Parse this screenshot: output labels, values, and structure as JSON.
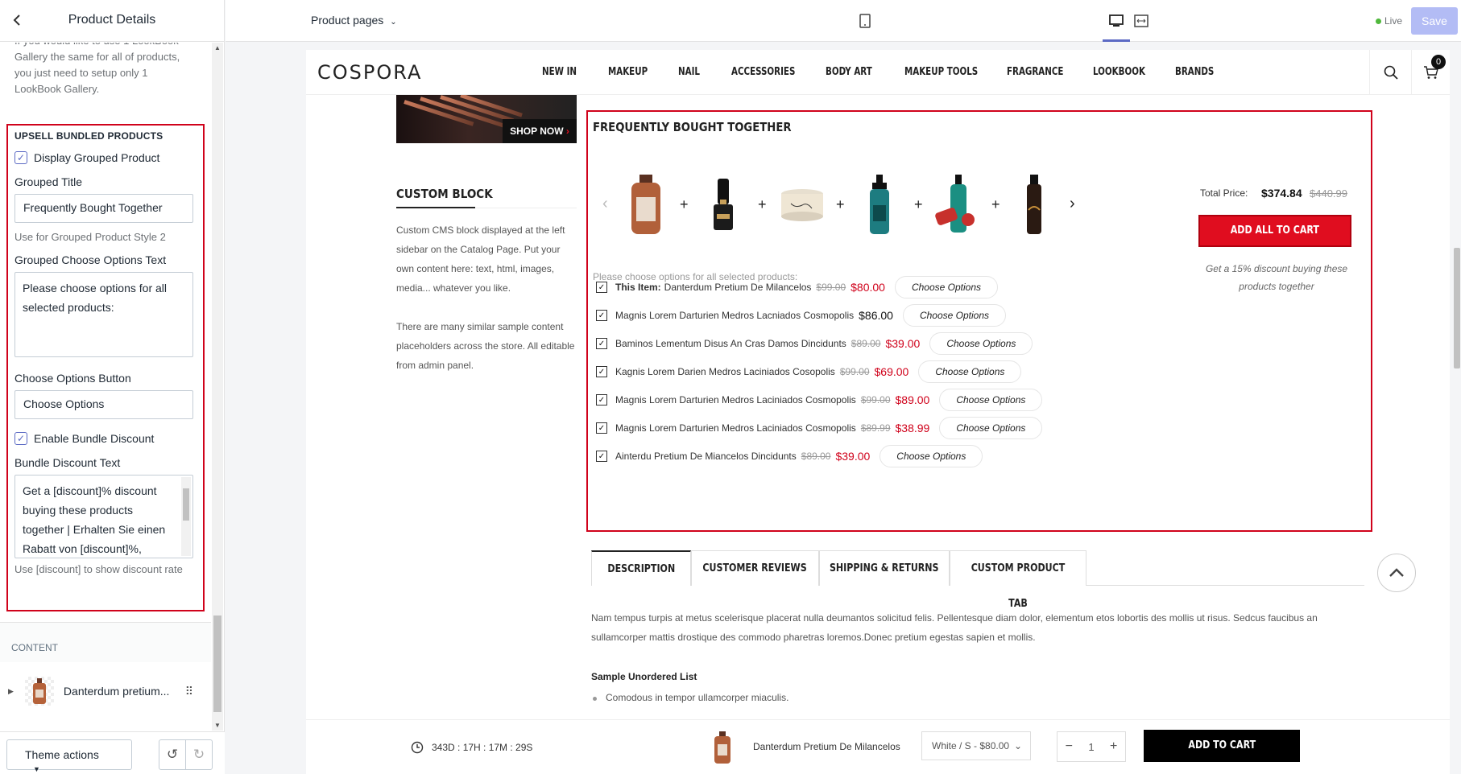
{
  "sidebar": {
    "title": "Product Details",
    "intro_text": "If you would like to use 1 LookBook Gallery the same for all of products, you just need to setup only 1 LookBook Gallery.",
    "upsell": {
      "heading": "UPSELL BUNDLED PRODUCTS",
      "display_grouped_label": "Display Grouped Product",
      "display_grouped_checked": true,
      "grouped_title_label": "Grouped Title",
      "grouped_title_value": "Frequently Bought Together",
      "grouped_title_help": "Use for Grouped Product Style 2",
      "choose_options_text_label": "Grouped Choose Options Text",
      "choose_options_text_value": "Please choose options for all selected products:",
      "choose_options_button_label": "Choose Options Button",
      "choose_options_button_value": "Choose Options",
      "enable_bundle_label": "Enable Bundle Discount",
      "enable_bundle_checked": true,
      "bundle_text_label": "Bundle Discount Text",
      "bundle_text_value": "Get a [discount]% discount buying these products together | Erhalten Sie einen Rabatt von [discount]%, wenn",
      "bundle_text_help": "Use [discount] to show discount rate"
    },
    "content_heading": "CONTENT",
    "content_item": "Danterdum pretium...",
    "footer": {
      "theme_actions": "Theme actions"
    }
  },
  "topbar": {
    "page_selector": "Product pages",
    "live_label": "Live",
    "save_label": "Save"
  },
  "store": {
    "logo": "COSPORA",
    "nav": [
      "NEW IN",
      "MAKEUP",
      "NAIL",
      "ACCESSORIES",
      "BODY ART",
      "MAKEUP TOOLS",
      "FRAGRANCE",
      "LOOKBOOK",
      "BRANDS"
    ],
    "cart_count": "0",
    "banner_button": "SHOP NOW",
    "custom_block": {
      "title": "CUSTOM BLOCK",
      "para1": "Custom CMS block displayed at the left sidebar on the Catalog Page. Put your own content here: text, html, images, media... whatever you like.",
      "para2": "There are many similar sample content placeholders across the store. All editable from admin panel."
    },
    "fbt": {
      "title": "FREQUENTLY BOUGHT TOGETHER",
      "total_label": "Total Price:",
      "total_price": "$374.84",
      "total_old": "$440.99",
      "add_all": "ADD ALL TO CART",
      "discount_text": "Get a 15% discount buying these products together",
      "choose_note": "Please choose options for all selected products:",
      "items": [
        {
          "prefix": "This Item:",
          "name": "Danterdum Pretium De Milancelos",
          "old": "$99.00",
          "price": "$80.00",
          "sale": true
        },
        {
          "prefix": "",
          "name": "Magnis Lorem Darturien Medros Lacniados Cosmopolis",
          "old": "",
          "price": "$86.00",
          "sale": false
        },
        {
          "prefix": "",
          "name": "Baminos Lementum Disus An Cras Damos Dincidunts",
          "old": "$89.00",
          "price": "$39.00",
          "sale": true
        },
        {
          "prefix": "",
          "name": "Kagnis Lorem Darien Medros Laciniados Cosopolis",
          "old": "$99.00",
          "price": "$69.00",
          "sale": true
        },
        {
          "prefix": "",
          "name": "Magnis Lorem Darturien Medros Laciniados Cosmopolis",
          "old": "$99.00",
          "price": "$89.00",
          "sale": true
        },
        {
          "prefix": "",
          "name": "Magnis Lorem Darturien Medros Laciniados Cosmopolis",
          "old": "$89.99",
          "price": "$38.99",
          "sale": true
        },
        {
          "prefix": "",
          "name": "Ainterdu Pretium De Miancelos Dincidunts",
          "old": "$89.00",
          "price": "$39.00",
          "sale": true
        }
      ],
      "choose_button": "Choose Options"
    },
    "tabs": [
      "DESCRIPTION",
      "CUSTOMER REVIEWS",
      "SHIPPING & RETURNS",
      "CUSTOM PRODUCT TAB"
    ],
    "description": "Nam tempus turpis at metus scelerisque placerat nulla deumantos solicitud felis. Pellentesque diam dolor, elementum etos lobortis des mollis ut risus. Sedcus faucibus an sullamcorper mattis drostique des commodo pharetras loremos.Donec pretium egestas sapien et mollis.",
    "sample_heading": "Sample Unordered List",
    "bullet": "Comodous in tempor ullamcorper miaculis.",
    "sticky": {
      "timer": "343D : 17H : 17M : 29S",
      "product_name": "Danterdum Pretium De Milancelos",
      "variant": "White / S - $80.00",
      "qty": "1",
      "add_to_cart": "ADD TO CART"
    }
  }
}
